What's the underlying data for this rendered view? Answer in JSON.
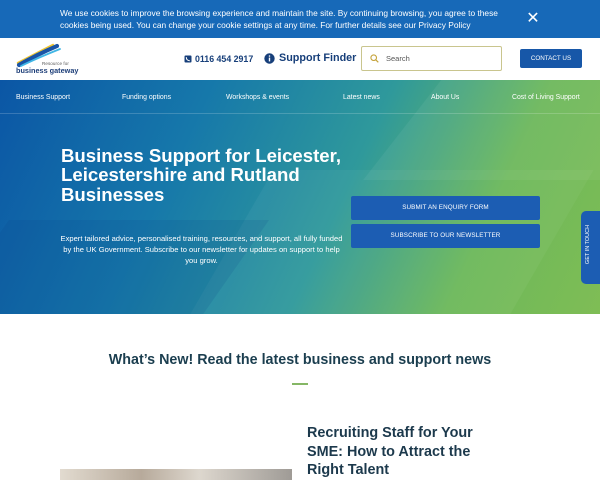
{
  "cookie_banner": {
    "message": "We use cookies to improve the browsing experience and maintain the site. By continuing browsing, you agree to these cookies being used. You can change your cookie settings at any time. For further details see our Privacy Policy",
    "close_icon": "close-icon",
    "close_symbol": "✕"
  },
  "header": {
    "logo": {
      "small_text": "Resource for",
      "text": "business gateway"
    },
    "phone": "0116 454 2917",
    "support_finder": "Support Finder",
    "search": {
      "placeholder": "Search"
    },
    "contact_button": "CONTACT US"
  },
  "nav": {
    "items": [
      {
        "label": "Business Support"
      },
      {
        "label": "Funding options"
      },
      {
        "label": "Workshops & events"
      },
      {
        "label": "Latest news"
      },
      {
        "label": "About Us"
      },
      {
        "label": "Cost of Living Support"
      }
    ]
  },
  "hero": {
    "title": "Business Support for Leicester, Leicestershire and Rutland Businesses",
    "description": "Expert tailored advice, personalised training, resources, and support, all fully funded by the UK Government. Subscribe to our newsletter for updates on support to help you grow.",
    "buttons": {
      "enquiry": "SUBMIT AN ENQUIRY FORM",
      "newsletter": "SUBSCRIBE TO OUR NEWSLETTER"
    },
    "get_in_touch": "GET IN TOUCH"
  },
  "news": {
    "heading": "What’s New! Read the latest business and support news",
    "articles": [
      {
        "title": "Recruiting Staff for Your SME: How to Attract the Right Talent"
      }
    ]
  },
  "colors": {
    "brand_blue": "#1769b8",
    "button_blue": "#1c5db3",
    "accent_green": "#85b765",
    "dark_text": "#1b3e4f"
  }
}
